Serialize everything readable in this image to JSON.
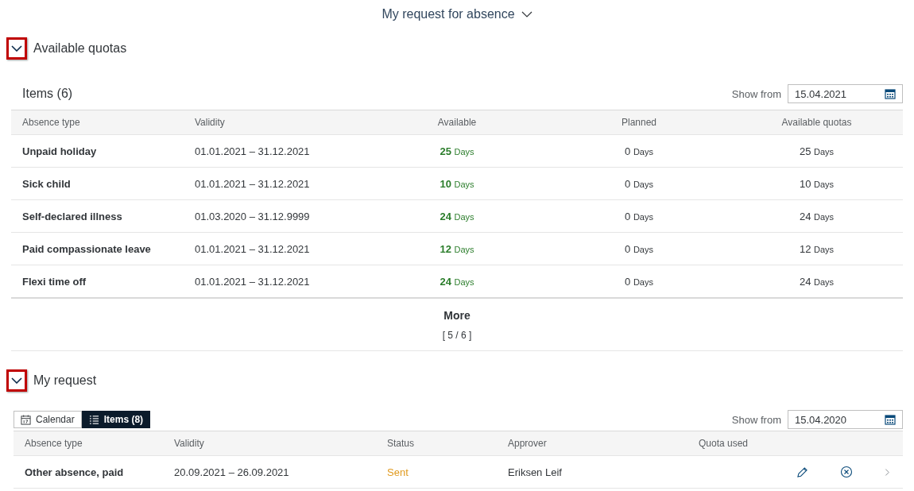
{
  "page_title": "My request for absence",
  "quotas": {
    "title": "Available quotas",
    "expanded": true,
    "highlighted": true,
    "items_title": "Items (6)",
    "show_from_label": "Show from",
    "show_from_value": "15.04.2021",
    "columns": [
      "Absence type",
      "Validity",
      "Available",
      "Planned",
      "Available quotas"
    ],
    "rows": [
      {
        "type": "Unpaid holiday",
        "validity": "01.01.2021 – 31.12.2021",
        "available": "25",
        "available_unit": "Days",
        "planned": "0",
        "planned_unit": "Days",
        "quota": "25",
        "quota_unit": "Days"
      },
      {
        "type": "Sick child",
        "validity": "01.01.2021 – 31.12.2021",
        "available": "10",
        "available_unit": "Days",
        "planned": "0",
        "planned_unit": "Days",
        "quota": "10",
        "quota_unit": "Days"
      },
      {
        "type": "Self-declared illness",
        "validity": "01.03.2020 – 31.12.9999",
        "available": "24",
        "available_unit": "Days",
        "planned": "0",
        "planned_unit": "Days",
        "quota": "24",
        "quota_unit": "Days"
      },
      {
        "type": "Paid compassionate leave",
        "validity": "01.01.2021 – 31.12.2021",
        "available": "12",
        "available_unit": "Days",
        "planned": "0",
        "planned_unit": "Days",
        "quota": "12",
        "quota_unit": "Days"
      },
      {
        "type": "Flexi time off",
        "validity": "01.01.2021 – 31.12.2021",
        "available": "24",
        "available_unit": "Days",
        "planned": "0",
        "planned_unit": "Days",
        "quota": "24",
        "quota_unit": "Days"
      }
    ],
    "more": "More",
    "more_count": "[ 5 / 6 ]"
  },
  "requests": {
    "title": "My request",
    "expanded": true,
    "highlighted": true,
    "views": [
      {
        "label": "Calendar",
        "kind": "calendar",
        "selected": false
      },
      {
        "label": "Items (8)",
        "kind": "list",
        "selected": true
      }
    ],
    "show_from_label": "Show from",
    "show_from_value": "15.04.2020",
    "columns": [
      "Absence type",
      "Validity",
      "Status",
      "Approver",
      "Quota used"
    ],
    "rows": [
      {
        "type": "Other absence, paid",
        "validity": "20.09.2021 – 26.09.2021",
        "status": "Sent",
        "color": "#e09a1e",
        "approver": "Eriksen Leif"
      }
    ]
  }
}
